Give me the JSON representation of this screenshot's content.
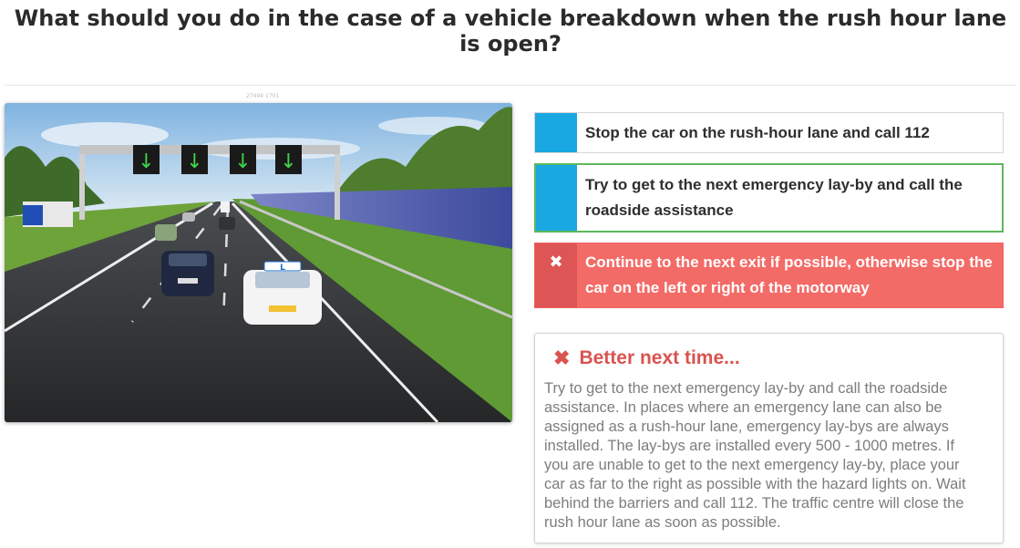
{
  "question": "What should you do in the case of a vehicle breakdown when the rush hour lane is open?",
  "image": {
    "caption": "27494 1701",
    "alt": "scene-image"
  },
  "answers": [
    {
      "label": "Stop the car on the rush-hour lane and call 112",
      "state": "neutral"
    },
    {
      "label": "Try to get to the next emergency lay-by and call the roadside assistance",
      "state": "correct"
    },
    {
      "label": "Continue to the next exit if possible, otherwise stop the car on the left or right of the motorway",
      "state": "wrong",
      "mark": "✖"
    }
  ],
  "feedback": {
    "icon": "✖",
    "title": "Better next time...",
    "body": "Try to get to the next emergency lay-by and call the roadside assistance. In places where an emergency lane can also be assigned as a rush-hour lane, emergency lay-bys are always installed. The lay-bys are installed every 500 - 1000 metres. If you are unable to get to the next emergency lay-by, place your car as far to the right as possible with the hazard lights on. Wait behind the barriers and call 112. The traffic centre will close the rush hour lane as soon as possible."
  },
  "colors": {
    "marker_blue": "#1aa8e2",
    "correct_border": "#5cb85c",
    "wrong_bg": "#f36b67",
    "feedback_red": "#d9534f"
  },
  "scene": {
    "lane_signs": [
      "↓",
      "↓",
      "↓",
      "↓"
    ],
    "car_plate": "L"
  }
}
